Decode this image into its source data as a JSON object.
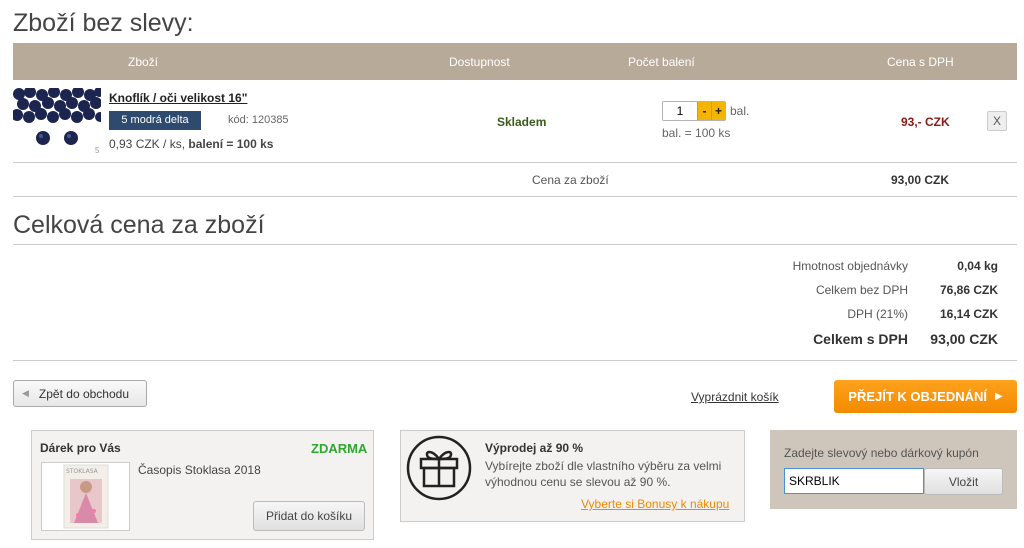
{
  "section_title": "Zboží bez slevy:",
  "table": {
    "headers": [
      "Zboží",
      "Dostupnost",
      "Počet balení",
      "Cena s DPH"
    ]
  },
  "product": {
    "name": "Knoflík / oči velikost 16\"",
    "variant": "5 modrá delta",
    "code": "kód: 120385",
    "price_per_unit": "0,93 CZK / ks,",
    "package_info": "balení = 100 ks",
    "image_badge": "5",
    "availability": "Skladem",
    "quantity": "1",
    "qty_minus": "-",
    "qty_plus": "+",
    "unit_label": "bal.",
    "package_note": "bal. = 100 ks",
    "price": "93,- CZK",
    "remove_label": "X"
  },
  "goods_price": {
    "label": "Cena za zboží",
    "value": "93,00 CZK"
  },
  "total_title": "Celková cena za zboží",
  "summary": [
    {
      "label": "Hmotnost objednávky",
      "value": "0,04 kg"
    },
    {
      "label": "Celkem bez DPH",
      "value": "76,86 CZK"
    },
    {
      "label": "DPH (21%)",
      "value": "16,14 CZK"
    },
    {
      "label": "Celkem s DPH",
      "value": "93,00 CZK"
    }
  ],
  "actions": {
    "back": "Zpět do obchodu",
    "empty_cart": "Vyprázdnit košík",
    "order": "PŘEJÍT K OBJEDNÁNÍ"
  },
  "gift": {
    "title": "Dárek pro Vás",
    "badge": "ZDARMA",
    "name": "Časopis Stoklasa 2018",
    "button": "Přidat do košíku",
    "cover_text": "STOKLASA"
  },
  "sale": {
    "title": "Výprodej až 90 %",
    "text": "Vybírejte zboží dle vlastního výběru za velmi výhodnou cenu se slevou až 90 %.",
    "link": "Vyberte si Bonusy k nákupu"
  },
  "coupon": {
    "label": "Zadejte slevový nebo dárkový kupón",
    "value": "SKRBLIK",
    "button": "Vložit"
  },
  "colors": {
    "header_bar": "#b8aa98",
    "price_red": "#8b1a1a",
    "available_green": "#3a5a1a",
    "free_green": "#2fa82f",
    "link_orange": "#f28a00"
  }
}
